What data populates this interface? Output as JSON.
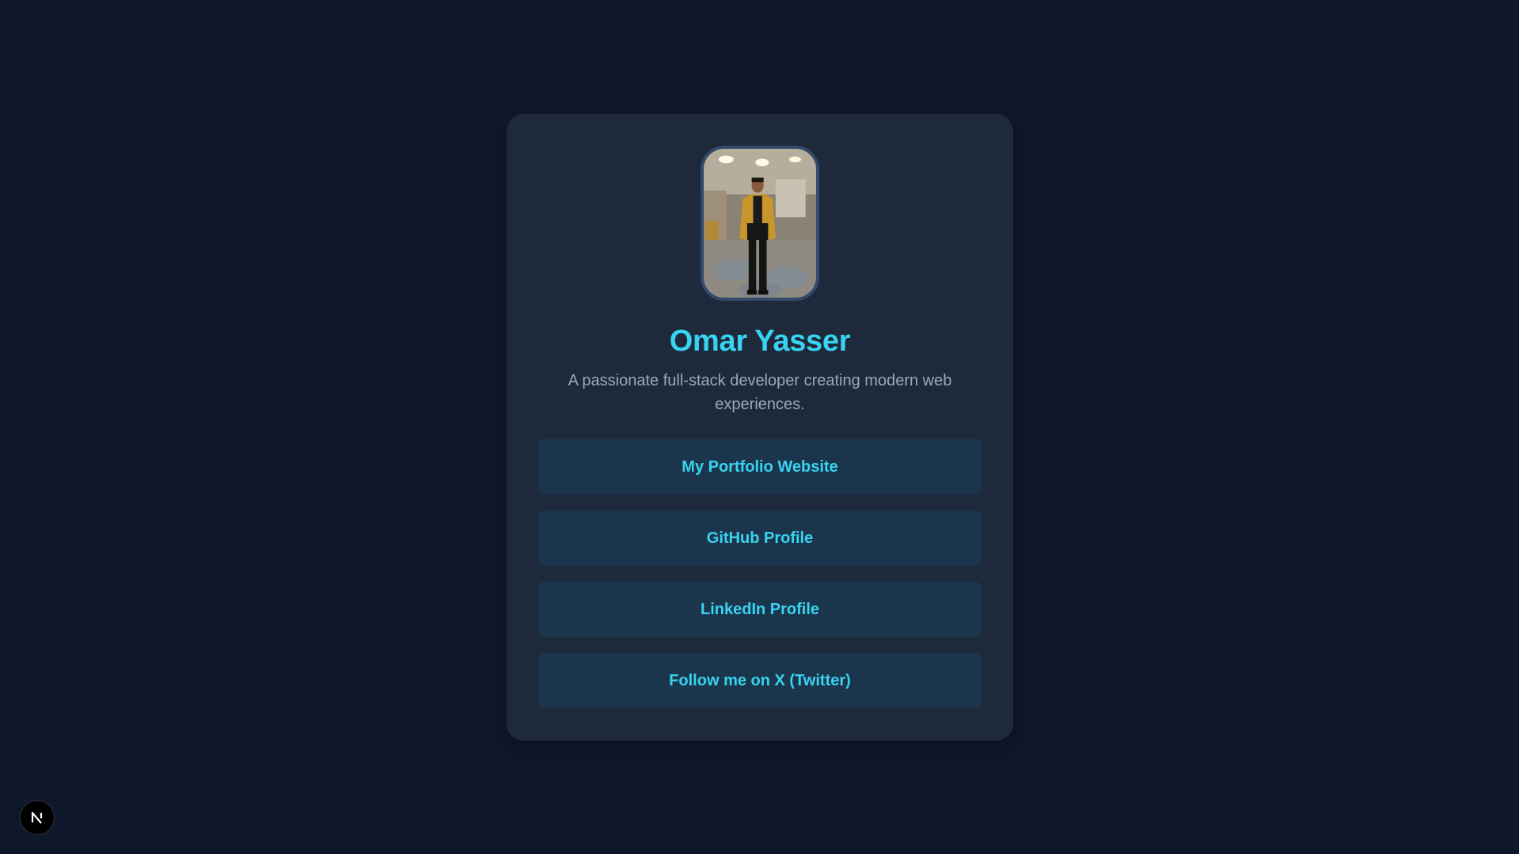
{
  "profile": {
    "name": "Omar Yasser",
    "bio": "A passionate full-stack developer creating modern web experiences."
  },
  "links": [
    {
      "label": "My Portfolio Website"
    },
    {
      "label": "GitHub Profile"
    },
    {
      "label": "LinkedIn Profile"
    },
    {
      "label": "Follow me on X (Twitter)"
    }
  ],
  "colors": {
    "background": "#0f172a",
    "card": "#1e293b",
    "accent": "#38d3f0",
    "button": "#1b364c",
    "muted_text": "#9ca8b8"
  },
  "icons": {
    "dev_badge": "nextjs-logo-icon"
  }
}
